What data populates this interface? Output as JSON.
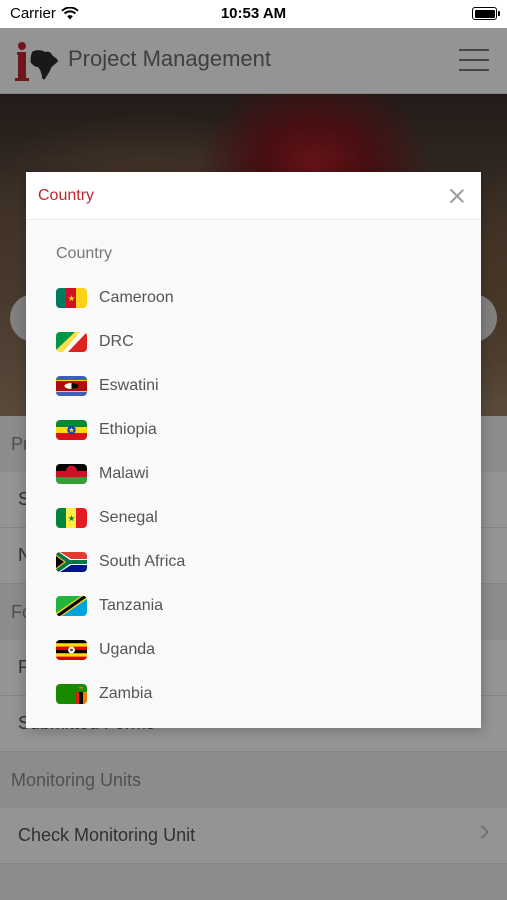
{
  "status_bar": {
    "carrier": "Carrier",
    "time": "10:53 AM"
  },
  "header": {
    "title": "Project Management"
  },
  "background_list": {
    "section1_header": "Pr",
    "row1_label": "S",
    "row2_label": "N",
    "section2_header": "Fo",
    "row3_label": "P",
    "row4_label": "Submitted Forms",
    "section3_header": "Monitoring Units",
    "row5_label": "Check Monitoring Unit"
  },
  "dialog": {
    "title": "Country",
    "field_label": "Country",
    "countries": [
      {
        "name": "Cameroon",
        "flag_icon": "cameroon-flag-icon"
      },
      {
        "name": "DRC",
        "flag_icon": "drc-flag-icon"
      },
      {
        "name": "Eswatini",
        "flag_icon": "eswatini-flag-icon"
      },
      {
        "name": "Ethiopia",
        "flag_icon": "ethiopia-flag-icon"
      },
      {
        "name": "Malawi",
        "flag_icon": "malawi-flag-icon"
      },
      {
        "name": "Senegal",
        "flag_icon": "senegal-flag-icon"
      },
      {
        "name": "South Africa",
        "flag_icon": "south-africa-flag-icon"
      },
      {
        "name": "Tanzania",
        "flag_icon": "tanzania-flag-icon"
      },
      {
        "name": "Uganda",
        "flag_icon": "uganda-flag-icon"
      },
      {
        "name": "Zambia",
        "flag_icon": "zambia-flag-icon"
      }
    ]
  },
  "colors": {
    "accent": "#c0272d",
    "overlay": "rgba(0,0,0,0.42)"
  }
}
